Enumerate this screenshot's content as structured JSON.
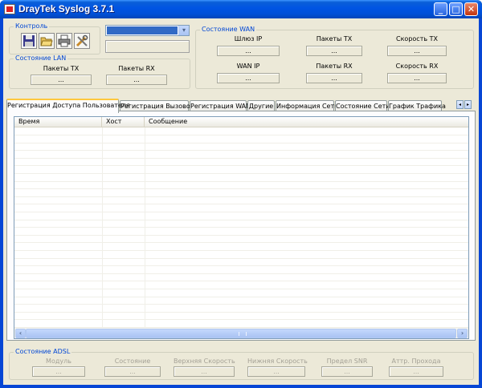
{
  "window": {
    "title": "DrayTek Syslog 3.7.1",
    "minimize_symbol": "_",
    "maximize_symbol": "□",
    "close_symbol": "✕"
  },
  "control": {
    "title": "Контроль",
    "buttons": [
      {
        "name": "save-icon"
      },
      {
        "name": "open-folder-icon"
      },
      {
        "name": "print-icon"
      },
      {
        "name": "tools-icon"
      }
    ],
    "combo_value": "",
    "combo_arrow": "▾",
    "text_value": ""
  },
  "lan": {
    "title": "Состояние LAN",
    "tx_label": "Пакеты TX",
    "rx_label": "Пакеты RX",
    "tx_value": "...",
    "rx_value": "..."
  },
  "wan": {
    "title": "Состояние WAN",
    "gateway_label": "Шлюз IP",
    "gateway_value": "...",
    "tx_label": "Пакеты TX",
    "tx_value": "...",
    "tx_speed_label": "Скорость TX",
    "tx_speed_value": "...",
    "wanip_label": "WAN IP",
    "wanip_value": "...",
    "rx_label": "Пакеты RX",
    "rx_value": "...",
    "rx_speed_label": "Скорость RX",
    "rx_speed_value": "..."
  },
  "tabs": [
    "Регистрация Доступа Пользователя",
    "Регистрация Вызовов",
    "Регистрация WAN",
    "Другие",
    "Информация Сети",
    "Состояние Сети",
    "График Трафика"
  ],
  "tab_scroll": {
    "left": "◂",
    "right": "▸"
  },
  "grid": {
    "columns": [
      "Время",
      "Хост",
      "Сообщение"
    ],
    "rows": [],
    "scroll_left": "‹",
    "scroll_right": "›"
  },
  "adsl": {
    "title": "Состояние ADSL",
    "fields": [
      {
        "label": "Модуль",
        "value": "..."
      },
      {
        "label": "Состояние",
        "value": "..."
      },
      {
        "label": "Верхняя Скорость",
        "value": "..."
      },
      {
        "label": "Нижняя Скорость",
        "value": "..."
      },
      {
        "label": "Предел SNR",
        "value": "..."
      },
      {
        "label": "Аттр. Прохода",
        "value": "..."
      }
    ]
  },
  "colors": {
    "titlebar": "#0054e3",
    "window_bg": "#ece9d8",
    "group_title": "#0046d5",
    "active_tab_accent": "#ffc83c",
    "combo_selection": "#316ac5"
  }
}
